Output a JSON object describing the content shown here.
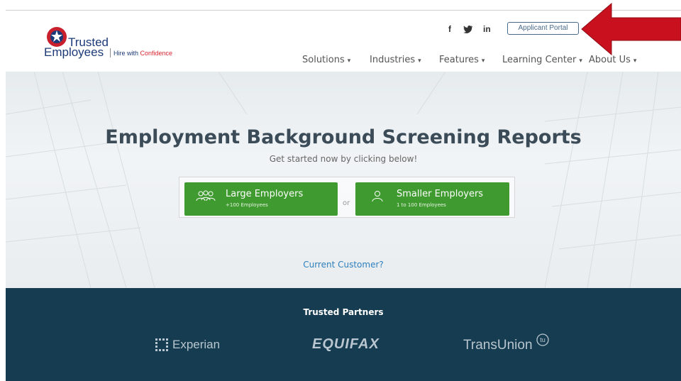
{
  "brand": {
    "name_line1": "Trusted",
    "name_line2": "Employees",
    "tagline_prefix": "Hire with ",
    "tagline_accent": "Confidence"
  },
  "social": {
    "facebook": "f",
    "twitter_icon": "twitter-bird-icon",
    "linkedin": "in"
  },
  "portal_button": "Applicant Portal",
  "nav": [
    {
      "label": "Solutions"
    },
    {
      "label": "Industries"
    },
    {
      "label": "Features"
    },
    {
      "label": "Learning Center"
    },
    {
      "label": "About Us"
    }
  ],
  "hero": {
    "title": "Employment Background Screening Reports",
    "subtitle": "Get started now by clicking below!",
    "large": {
      "title": "Large Employers",
      "sub": "+100 Employees",
      "icon": "group-icon"
    },
    "or": "or",
    "small": {
      "title": "Smaller Employers",
      "sub": "1 to 100 Employees",
      "icon": "person-icon"
    },
    "current_customer": "Current Customer?"
  },
  "partners": {
    "title": "Trusted Partners",
    "experian": "Experian",
    "equifax": "EQUIFAX",
    "transunion": "TransUnion"
  },
  "colors": {
    "accent_green": "#3f9a2f",
    "footer_navy": "#153c50",
    "arrow_red": "#c8101e",
    "brand_blue": "#1d3a78"
  }
}
